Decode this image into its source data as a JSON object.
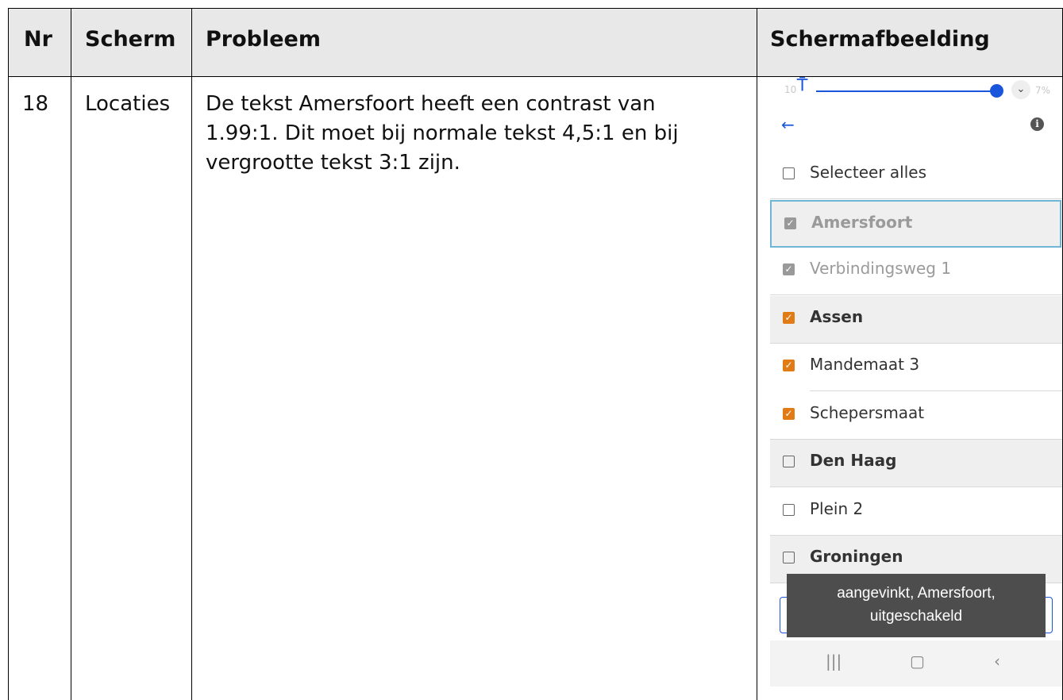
{
  "table": {
    "headers": [
      "Nr",
      "Scherm",
      "Probleem",
      "Schermafbeelding"
    ],
    "row": {
      "nr": "18",
      "scherm": "Locaties",
      "probleem": [
        "De tekst Amersfoort heeft een contrast van",
        "1.99:1. Dit moet bij normale tekst 4,5:1 en bij",
        "vergrootte tekst 3:1 zijn."
      ]
    }
  },
  "screenshot": {
    "status_left": "10",
    "status_right": "7%",
    "icons": {
      "accessibility": "accessibility-icon",
      "back": "arrow-left-icon",
      "info": "info-icon"
    },
    "accent_color": "#1a56db",
    "check_color": "#e07b16",
    "items": [
      {
        "label": "Selecteer alles",
        "checked": false,
        "group": false
      },
      {
        "label": "Amersfoort",
        "checked": true,
        "group": true,
        "disabled": true,
        "focused": true
      },
      {
        "label": "Verbindingsweg 1",
        "checked": true,
        "group": false,
        "disabled": true
      },
      {
        "label": "Assen",
        "checked": true,
        "group": true
      },
      {
        "label": "Mandemaat 3",
        "checked": true,
        "group": false
      },
      {
        "label": "Schepersmaat",
        "checked": true,
        "group": false
      },
      {
        "label": "Den Haag",
        "checked": false,
        "group": true
      },
      {
        "label": "Plein 2",
        "checked": false,
        "group": false
      },
      {
        "label": "Groningen",
        "checked": false,
        "group": true
      }
    ],
    "toast": [
      "aangevinkt, Amersfoort,",
      "uitgeschakeld"
    ],
    "nav": {
      "recent": "|||",
      "home": "▢",
      "back": "‹"
    }
  }
}
